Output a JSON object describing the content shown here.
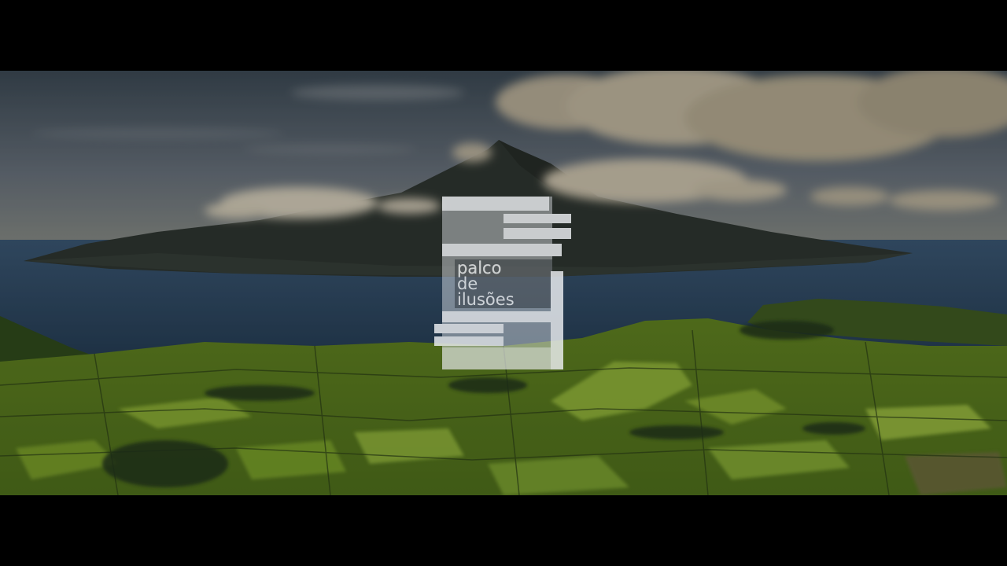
{
  "video": {
    "logo_line_1": "palco",
    "logo_line_2": "de",
    "logo_line_3": "ilusões"
  },
  "colors": {
    "letterbox": "#000000",
    "sky_top": "#3d4a55",
    "sky_bottom": "#8a8f85",
    "ocean": "#2e4a63",
    "mountain": "#2f3530",
    "fields": "#7fa02a",
    "logo_fill": "#e6e9ee"
  },
  "icons": [
    "mountain-island",
    "clouds",
    "fields"
  ]
}
